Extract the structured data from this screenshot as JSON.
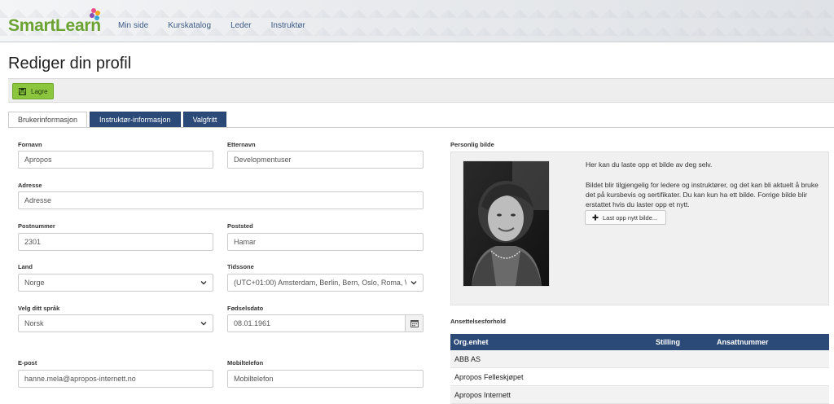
{
  "header": {
    "logo_smart": "Smart",
    "logo_learn": "Learn",
    "nav": [
      "Min side",
      "Kurskatalog",
      "Leder",
      "Instruktør"
    ]
  },
  "page_title": "Rediger din profil",
  "toolbar": {
    "save_label": "Lagre"
  },
  "tabs": [
    "Brukerinformasjon",
    "Instruktør-informasjon",
    "Valgfritt"
  ],
  "form": {
    "fornavn": {
      "label": "Fornavn",
      "value": "Apropos"
    },
    "etternavn": {
      "label": "Etternavn",
      "value": "Developmentuser"
    },
    "adresse": {
      "label": "Adresse",
      "placeholder": "Adresse"
    },
    "postnummer": {
      "label": "Postnummer",
      "value": "2301"
    },
    "poststed": {
      "label": "Poststed",
      "value": "Hamar"
    },
    "land": {
      "label": "Land",
      "value": "Norge"
    },
    "tidssone": {
      "label": "Tidssone",
      "value": "(UTC+01:00) Amsterdam, Berlin, Bern, Oslo, Roma, W"
    },
    "sprak": {
      "label": "Velg ditt språk",
      "value": "Norsk"
    },
    "fodselsdato": {
      "label": "Fødselsdato",
      "value": "08.01.1961"
    },
    "epost": {
      "label": "E-post",
      "value": "hanne.mela@apropos-internett.no"
    },
    "mobil": {
      "label": "Mobiltelefon",
      "placeholder": "Mobiltelefon"
    }
  },
  "photo": {
    "label": "Personlig bilde",
    "text1": "Her kan du laste opp et bilde av deg selv.",
    "text2": "Bildet blir tilgjengelig for ledere og instruktører, og det kan bli aktuelt å bruke det på kursbevis og sertifikater. Du kan kun ha ett bilde. Forrige bilde blir erstattet hvis du laster opp et nytt.",
    "upload_label": "Last opp nytt bilde..."
  },
  "employment": {
    "title": "Ansettelsesforhold",
    "columns": [
      "Org.enhet",
      "Stilling",
      "Ansattnummer"
    ],
    "rows": [
      "ABB AS",
      "Apropos Felleskjøpet",
      "Apropos Internett"
    ]
  },
  "colors": {
    "brand_green": "#6aa332",
    "tab_blue": "#2c4a78",
    "save_green": "#8cc63f"
  }
}
